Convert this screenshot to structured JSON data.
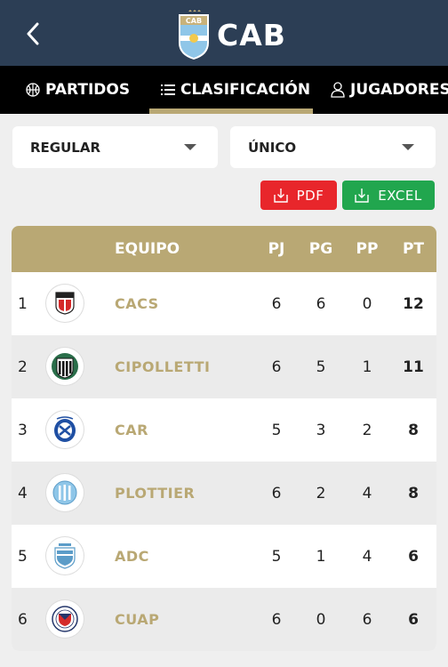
{
  "header": {
    "brand": "CAB",
    "logo_text": "CAB",
    "back_icon": "chevron-left-icon",
    "colors": {
      "bar": "#2c3e55",
      "gold": "#b9a874"
    }
  },
  "tabs": [
    {
      "label": "PARTIDOS",
      "icon": "basketball-icon",
      "active": false
    },
    {
      "label": "CLASIFICACIÓN",
      "icon": "list-icon",
      "active": true
    },
    {
      "label": "JUGADORES",
      "icon": "user-icon",
      "active": false
    }
  ],
  "filters": {
    "phase": "REGULAR",
    "group": "ÚNICO"
  },
  "export": {
    "pdf_label": "PDF",
    "excel_label": "EXCEL",
    "pdf_color": "#e8262b",
    "excel_color": "#21a64e"
  },
  "standings": {
    "headers": {
      "team": "EQUIPO",
      "pj": "PJ",
      "pg": "PG",
      "pp": "PP",
      "pt": "PT"
    },
    "rows": [
      {
        "pos": "1",
        "team": "CACS",
        "pj": "6",
        "pg": "6",
        "pp": "0",
        "pt": "12"
      },
      {
        "pos": "2",
        "team": "CIPOLLETTI",
        "pj": "6",
        "pg": "5",
        "pp": "1",
        "pt": "11"
      },
      {
        "pos": "3",
        "team": "CAR",
        "pj": "5",
        "pg": "3",
        "pp": "2",
        "pt": "8"
      },
      {
        "pos": "4",
        "team": "PLOTTIER",
        "pj": "6",
        "pg": "2",
        "pp": "4",
        "pt": "8"
      },
      {
        "pos": "5",
        "team": "ADC",
        "pj": "5",
        "pg": "1",
        "pp": "4",
        "pt": "6"
      },
      {
        "pos": "6",
        "team": "CUAP",
        "pj": "6",
        "pg": "0",
        "pp": "6",
        "pt": "6"
      }
    ]
  }
}
